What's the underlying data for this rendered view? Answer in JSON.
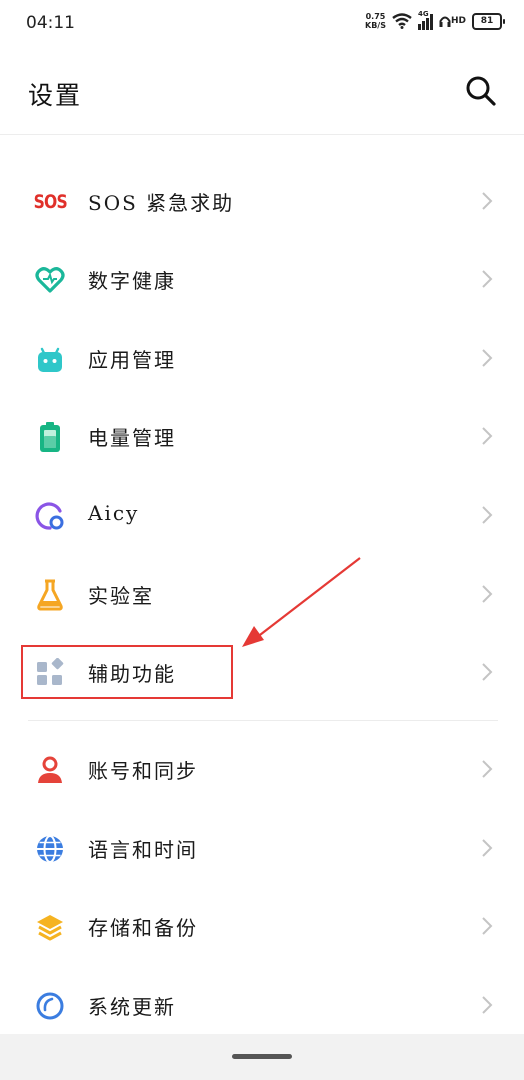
{
  "status_bar": {
    "time": "04:11",
    "net_speed_value": "0.75",
    "net_speed_unit": "KB/S",
    "network_type": "4G",
    "hd_label": "HD",
    "battery_level": "81"
  },
  "header": {
    "title": "设置"
  },
  "items": [
    {
      "label": "SOS 紧急求助",
      "icon_text": "SOS"
    },
    {
      "label": "数字健康"
    },
    {
      "label": "应用管理"
    },
    {
      "label": "电量管理"
    },
    {
      "label": "Aicy"
    },
    {
      "label": "实验室"
    },
    {
      "label": "辅助功能"
    },
    {
      "label": "账号和同步"
    },
    {
      "label": "语言和时间"
    },
    {
      "label": "存储和备份"
    },
    {
      "label": "系统更新"
    }
  ],
  "colors": {
    "sos": "#e0302a",
    "wellbeing": "#1bb79a",
    "apps": "#2fc7c9",
    "battery": "#17b584",
    "aicy": "#7a4fe0",
    "lab": "#f5a623",
    "accessibility": "#9fb0c6",
    "account": "#e5433a",
    "language": "#3b7de0",
    "storage": "#f5b321",
    "update": "#3b7de0",
    "annotation": "#e53935"
  },
  "icons": {
    "sos": "sos-icon",
    "wellbeing": "heart-icon",
    "apps": "android-icon",
    "battery": "battery-icon",
    "aicy": "aicy-icon",
    "lab": "flask-icon",
    "accessibility": "grid-icon",
    "account": "person-icon",
    "language": "globe-icon",
    "storage": "layers-icon",
    "update": "update-icon"
  }
}
